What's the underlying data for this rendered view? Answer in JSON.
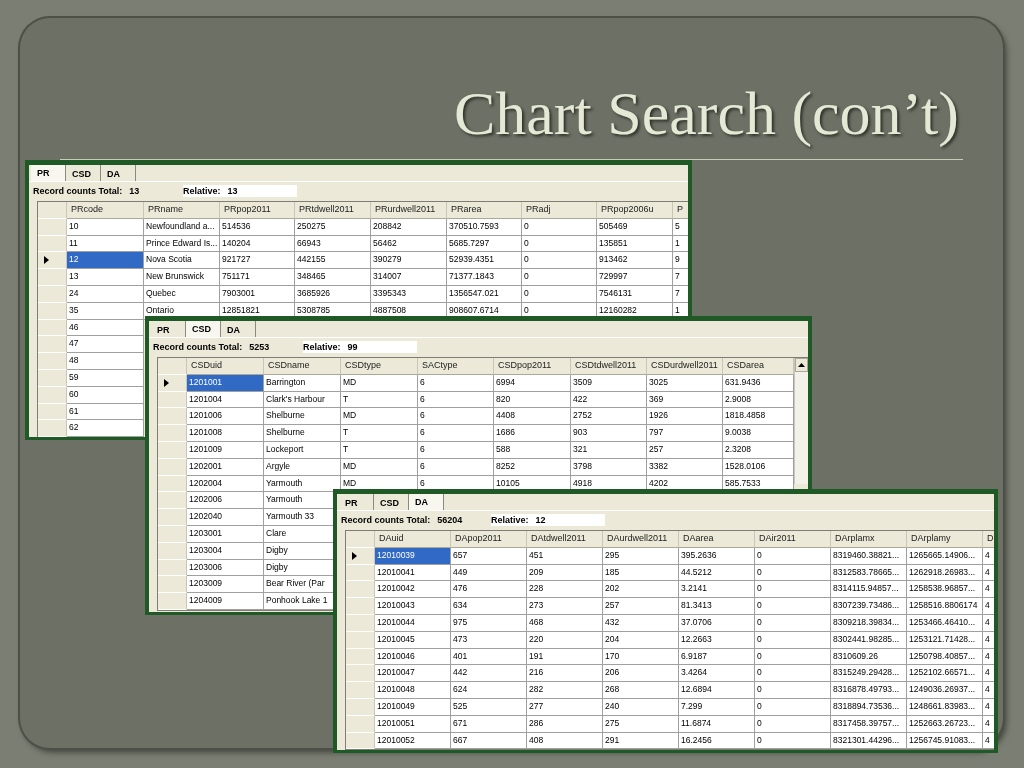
{
  "slide": {
    "title": "Chart Search (con’t)"
  },
  "windows": [
    {
      "tabs": [
        {
          "label": "PR",
          "selected": true
        },
        {
          "label": "CSD",
          "selected": false
        },
        {
          "label": "DA",
          "selected": false
        }
      ],
      "total_label": "Record counts Total:",
      "total": "13",
      "relative_label": "Relative:",
      "relative": "13",
      "columns": [
        "PRcode",
        "PRname",
        "PRpop2011",
        "PRtdwell2011",
        "PRurdwell2011",
        "PRarea",
        "PRadj",
        "PRpop2006u",
        "P"
      ],
      "rows": [
        {
          "selected": false,
          "cells": [
            "10",
            "Newfoundland a...",
            "514536",
            "250275",
            "208842",
            "370510.7593",
            "0",
            "505469",
            "5"
          ]
        },
        {
          "selected": false,
          "cells": [
            "11",
            "Prince Edward Is...",
            "140204",
            "66943",
            "56462",
            "5685.7297",
            "0",
            "135851",
            "1"
          ]
        },
        {
          "selected": true,
          "cells": [
            "12",
            "Nova Scotia",
            "921727",
            "442155",
            "390279",
            "52939.4351",
            "0",
            "913462",
            "9"
          ]
        },
        {
          "selected": false,
          "cells": [
            "13",
            "New Brunswick",
            "751171",
            "348465",
            "314007",
            "71377.1843",
            "0",
            "729997",
            "7"
          ]
        },
        {
          "selected": false,
          "cells": [
            "24",
            "Quebec",
            "7903001",
            "3685926",
            "3395343",
            "1356547.021",
            "0",
            "7546131",
            "7"
          ]
        },
        {
          "selected": false,
          "cells": [
            "35",
            "Ontario",
            "12851821",
            "5308785",
            "4887508",
            "908607.6714",
            "0",
            "12160282",
            "1"
          ]
        },
        {
          "selected": false,
          "cells": [
            "46"
          ]
        },
        {
          "selected": false,
          "cells": [
            "47"
          ]
        },
        {
          "selected": false,
          "cells": [
            "48"
          ]
        },
        {
          "selected": false,
          "cells": [
            "59"
          ]
        },
        {
          "selected": false,
          "cells": [
            "60"
          ]
        },
        {
          "selected": false,
          "cells": [
            "61"
          ]
        },
        {
          "selected": false,
          "cells": [
            "62"
          ]
        }
      ]
    },
    {
      "tabs": [
        {
          "label": "PR",
          "selected": false
        },
        {
          "label": "CSD",
          "selected": true
        },
        {
          "label": "DA",
          "selected": false
        }
      ],
      "total_label": "Record counts Total:",
      "total": "5253",
      "relative_label": "Relative:",
      "relative": "99",
      "columns": [
        "CSDuid",
        "CSDname",
        "CSDtype",
        "SACtype",
        "CSDpop2011",
        "CSDtdwell2011",
        "CSDurdwell2011",
        "CSDarea"
      ],
      "rows": [
        {
          "selected": true,
          "cells": [
            "1201001",
            "Barrington",
            "MD",
            "6",
            "6994",
            "3509",
            "3025",
            "631.9436"
          ]
        },
        {
          "selected": false,
          "cells": [
            "1201004",
            "Clark's Harbour",
            "T",
            "6",
            "820",
            "422",
            "369",
            "2.9008"
          ]
        },
        {
          "selected": false,
          "cells": [
            "1201006",
            "Shelburne",
            "MD",
            "6",
            "4408",
            "2752",
            "1926",
            "1818.4858"
          ]
        },
        {
          "selected": false,
          "cells": [
            "1201008",
            "Shelburne",
            "T",
            "6",
            "1686",
            "903",
            "797",
            "9.0038"
          ]
        },
        {
          "selected": false,
          "cells": [
            "1201009",
            "Lockeport",
            "T",
            "6",
            "588",
            "321",
            "257",
            "2.3208"
          ]
        },
        {
          "selected": false,
          "cells": [
            "1202001",
            "Argyle",
            "MD",
            "6",
            "8252",
            "3798",
            "3382",
            "1528.0106"
          ]
        },
        {
          "selected": false,
          "cells": [
            "1202004",
            "Yarmouth",
            "MD",
            "6",
            "10105",
            "4918",
            "4202",
            "585.7533"
          ]
        },
        {
          "selected": false,
          "cells": [
            "1202006",
            "Yarmouth"
          ]
        },
        {
          "selected": false,
          "cells": [
            "1202040",
            "Yarmouth 33"
          ]
        },
        {
          "selected": false,
          "cells": [
            "1203001",
            "Clare"
          ]
        },
        {
          "selected": false,
          "cells": [
            "1203004",
            "Digby"
          ]
        },
        {
          "selected": false,
          "cells": [
            "1203006",
            "Digby"
          ]
        },
        {
          "selected": false,
          "cells": [
            "1203009",
            "Bear River (Par"
          ]
        },
        {
          "selected": false,
          "cells": [
            "1204009",
            "Ponhook Lake 1"
          ]
        }
      ]
    },
    {
      "tabs": [
        {
          "label": "PR",
          "selected": false
        },
        {
          "label": "CSD",
          "selected": false
        },
        {
          "label": "DA",
          "selected": true
        }
      ],
      "total_label": "Record counts Total:",
      "total": "56204",
      "relative_label": "Relative:",
      "relative": "12",
      "columns": [
        "DAuid",
        "DApop2011",
        "DAtdwell2011",
        "DAurdwell2011",
        "DAarea",
        "DAir2011",
        "DArplamx",
        "DArplamy",
        "D"
      ],
      "rows": [
        {
          "selected": true,
          "cells": [
            "12010039",
            "657",
            "451",
            "295",
            "395.2636",
            "0",
            "8319460.38821...",
            "1265665.14906...",
            "4"
          ]
        },
        {
          "selected": false,
          "cells": [
            "12010041",
            "449",
            "209",
            "185",
            "44.5212",
            "0",
            "8312583.78665...",
            "1262918.26983...",
            "4"
          ]
        },
        {
          "selected": false,
          "cells": [
            "12010042",
            "476",
            "228",
            "202",
            "3.2141",
            "0",
            "8314115.94857...",
            "1258538.96857...",
            "4"
          ]
        },
        {
          "selected": false,
          "cells": [
            "12010043",
            "634",
            "273",
            "257",
            "81.3413",
            "0",
            "8307239.73486...",
            "1258516.8806174",
            "4"
          ]
        },
        {
          "selected": false,
          "cells": [
            "12010044",
            "975",
            "468",
            "432",
            "37.0706",
            "0",
            "8309218.39834...",
            "1253466.46410...",
            "4"
          ]
        },
        {
          "selected": false,
          "cells": [
            "12010045",
            "473",
            "220",
            "204",
            "12.2663",
            "0",
            "8302441.98285...",
            "1253121.71428...",
            "4"
          ]
        },
        {
          "selected": false,
          "cells": [
            "12010046",
            "401",
            "191",
            "170",
            "6.9187",
            "0",
            "8310609.26",
            "1250798.40857...",
            "4"
          ]
        },
        {
          "selected": false,
          "cells": [
            "12010047",
            "442",
            "216",
            "206",
            "3.4264",
            "0",
            "8315249.29428...",
            "1252102.66571...",
            "4"
          ]
        },
        {
          "selected": false,
          "cells": [
            "12010048",
            "624",
            "282",
            "268",
            "12.6894",
            "0",
            "8316878.49793...",
            "1249036.26937...",
            "4"
          ]
        },
        {
          "selected": false,
          "cells": [
            "12010049",
            "525",
            "277",
            "240",
            "7.299",
            "0",
            "8318894.73536...",
            "1248661.83983...",
            "4"
          ]
        },
        {
          "selected": false,
          "cells": [
            "12010051",
            "671",
            "286",
            "275",
            "11.6874",
            "0",
            "8317458.39757...",
            "1252663.26723...",
            "4"
          ]
        },
        {
          "selected": false,
          "cells": [
            "12010052",
            "667",
            "408",
            "291",
            "16.2456",
            "0",
            "8321301.44296...",
            "1256745.91083...",
            "4"
          ]
        }
      ]
    }
  ]
}
